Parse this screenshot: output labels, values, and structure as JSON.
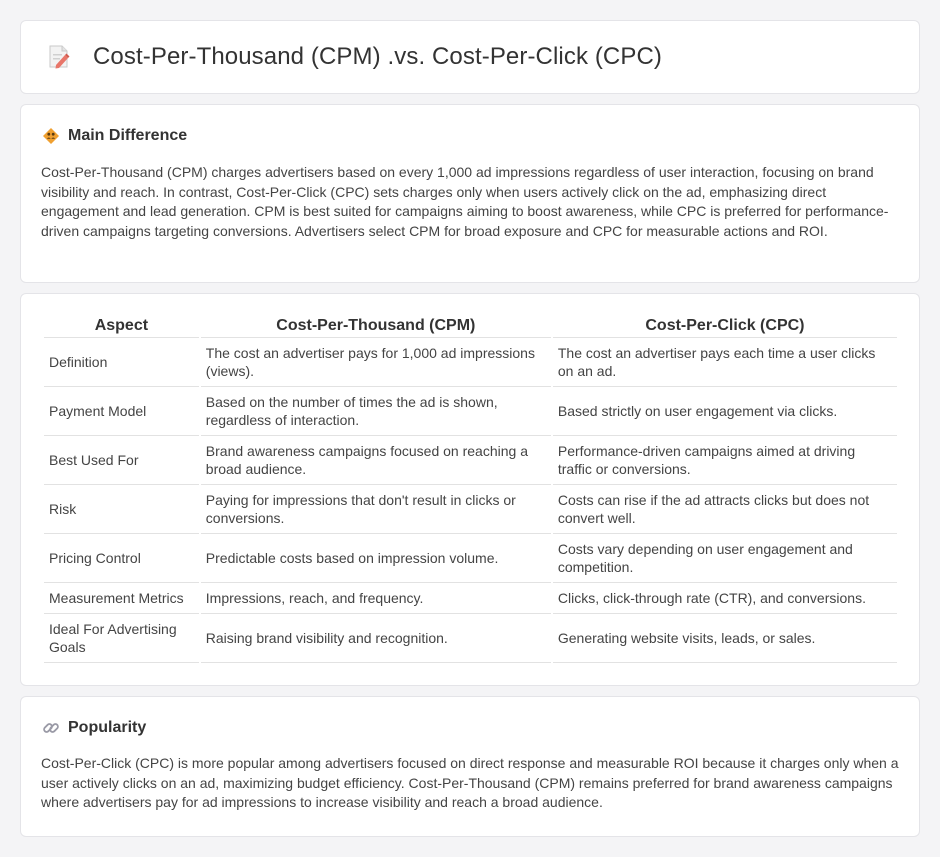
{
  "header": {
    "title": "Cost-Per-Thousand (CPM) .vs. Cost-Per-Click (CPC)",
    "icon": "document-pencil-icon"
  },
  "main_difference": {
    "title": "Main Difference",
    "icon": "diamond-people-icon",
    "text": "Cost-Per-Thousand (CPM) charges advertisers based on every 1,000 ad impressions regardless of user interaction, focusing on brand visibility and reach. In contrast, Cost-Per-Click (CPC) sets charges only when users actively click on the ad, emphasizing direct engagement and lead generation. CPM is best suited for campaigns aiming to boost awareness, while CPC is preferred for performance-driven campaigns targeting conversions. Advertisers select CPM for broad exposure and CPC for measurable actions and ROI."
  },
  "comparison": {
    "headers": [
      "Aspect",
      "Cost-Per-Thousand (CPM)",
      "Cost-Per-Click (CPC)"
    ],
    "rows": [
      {
        "aspect": "Definition",
        "cpm": "The cost an advertiser pays for 1,000 ad impressions (views).",
        "cpc": "The cost an advertiser pays each time a user clicks on an ad."
      },
      {
        "aspect": "Payment Model",
        "cpm": "Based on the number of times the ad is shown, regardless of interaction.",
        "cpc": "Based strictly on user engagement via clicks."
      },
      {
        "aspect": "Best Used For",
        "cpm": "Brand awareness campaigns focused on reaching a broad audience.",
        "cpc": "Performance-driven campaigns aimed at driving traffic or conversions."
      },
      {
        "aspect": "Risk",
        "cpm": "Paying for impressions that don't result in clicks or conversions.",
        "cpc": "Costs can rise if the ad attracts clicks but does not convert well."
      },
      {
        "aspect": "Pricing Control",
        "cpm": "Predictable costs based on impression volume.",
        "cpc": "Costs vary depending on user engagement and competition."
      },
      {
        "aspect": "Measurement Metrics",
        "cpm": "Impressions, reach, and frequency.",
        "cpc": "Clicks, click-through rate (CTR), and conversions."
      },
      {
        "aspect": "Ideal For Advertising Goals",
        "cpm": "Raising brand visibility and recognition.",
        "cpc": "Generating website visits, leads, or sales."
      }
    ]
  },
  "popularity": {
    "title": "Popularity",
    "icon": "link-icon",
    "text": "Cost-Per-Click (CPC) is more popular among advertisers focused on direct response and measurable ROI because it charges only when a user actively clicks on an ad, maximizing budget efficiency. Cost-Per-Thousand (CPM) remains preferred for brand awareness campaigns where advertisers pay for ad impressions to increase visibility and reach a broad audience."
  },
  "colors": {
    "background": "#f4f4f6",
    "card": "#ffffff",
    "accent_orange": "#f0a030",
    "icon_pink": "#e8766a"
  }
}
